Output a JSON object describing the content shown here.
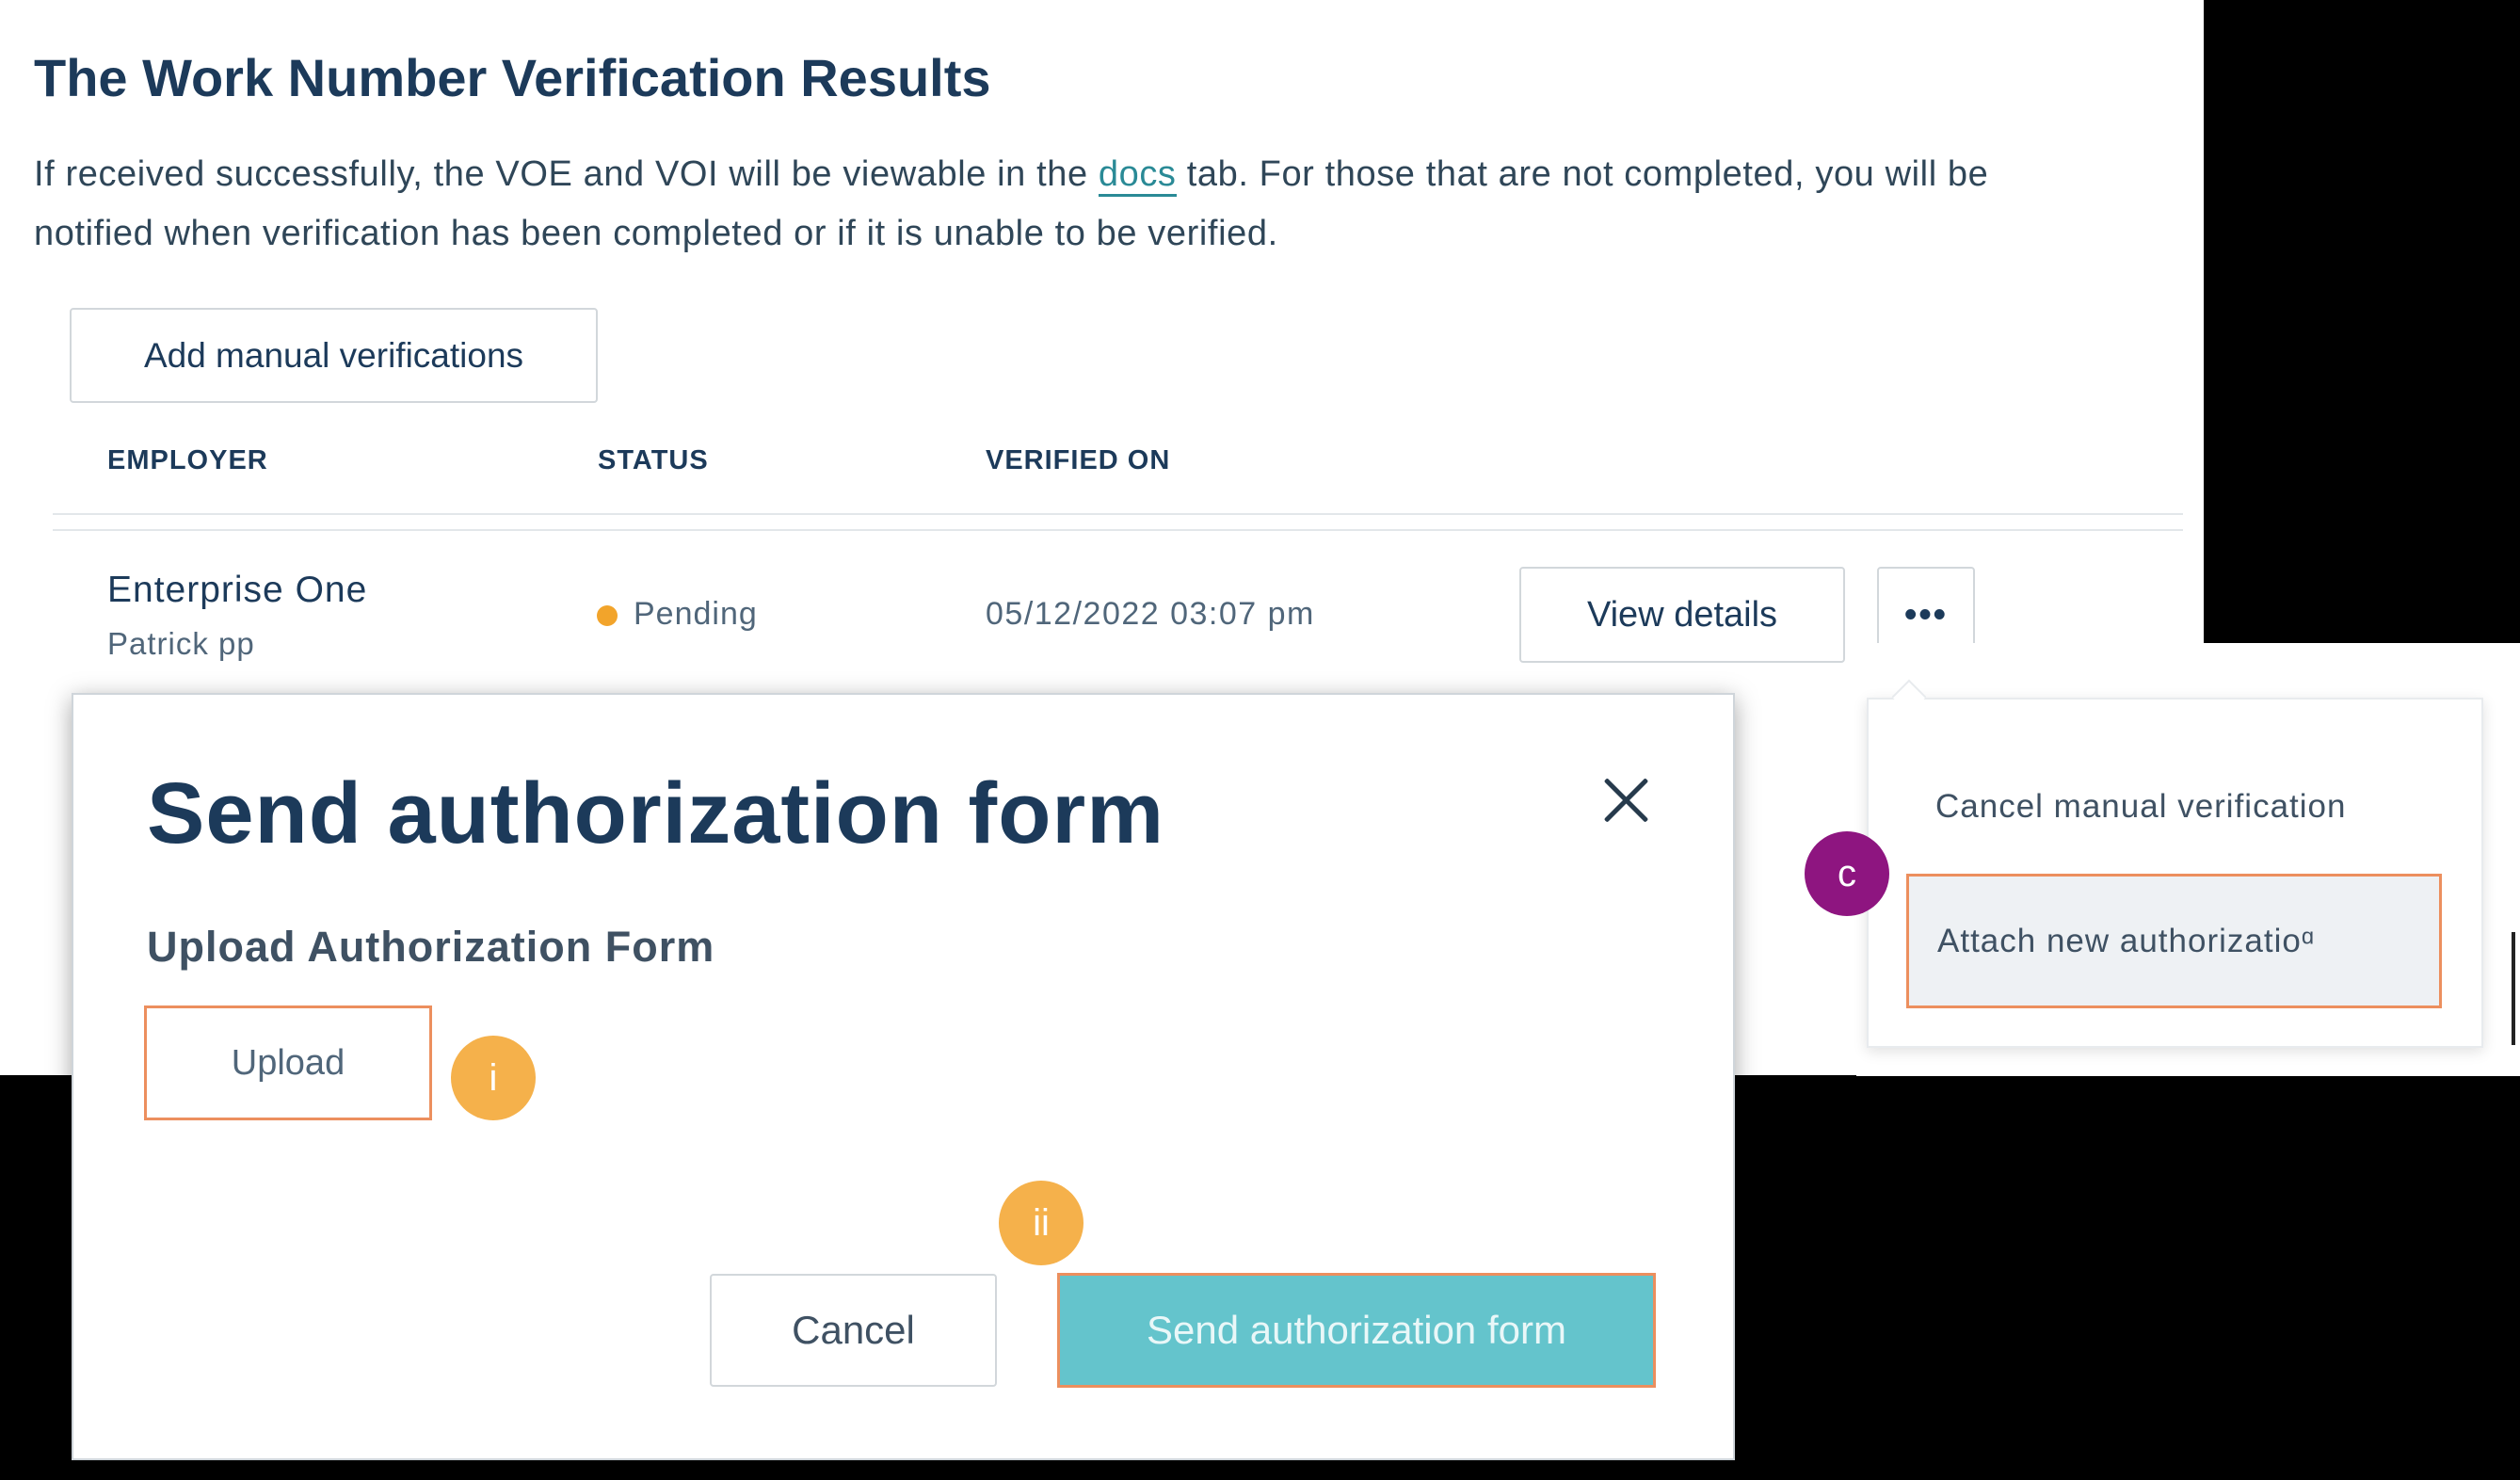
{
  "page": {
    "title": "The Work Number Verification Results",
    "intro_before_link": "If received successfully, the VOE and VOI will be viewable in the ",
    "intro_link": "docs",
    "intro_after_link": " tab. For those that are not completed, you will be notified when verification has been completed or if it is unable to be verified.",
    "add_manual_label": "Add manual verifications"
  },
  "table": {
    "headers": [
      "EMPLOYER",
      "STATUS",
      "VERIFIED ON"
    ],
    "rows": [
      {
        "employer": "Enterprise One",
        "employer_sub": "Patrick pp",
        "status": "Pending",
        "status_color": "#f2a42b",
        "verified_on": "05/12/2022 03:07 pm",
        "view_details_label": "View details",
        "more_label": "•••"
      }
    ]
  },
  "dropdown": {
    "items": [
      "Cancel manual verification",
      "Attach new authorizatioᵅ"
    ]
  },
  "modal": {
    "title": "Send authorization form",
    "upload_section_label": "Upload Authorization Form",
    "upload_label": "Upload",
    "cancel_label": "Cancel",
    "send_label": "Send authorization form",
    "close_icon": "close-icon"
  },
  "badges": {
    "i": "i",
    "ii": "ii",
    "c": "c"
  },
  "colors": {
    "primary_text": "#1c3a5a",
    "accent_teal": "#64c4cc",
    "highlight_orange": "#ec8f5e",
    "badge_orange": "#f5b14b",
    "badge_purple": "#8e1580"
  }
}
